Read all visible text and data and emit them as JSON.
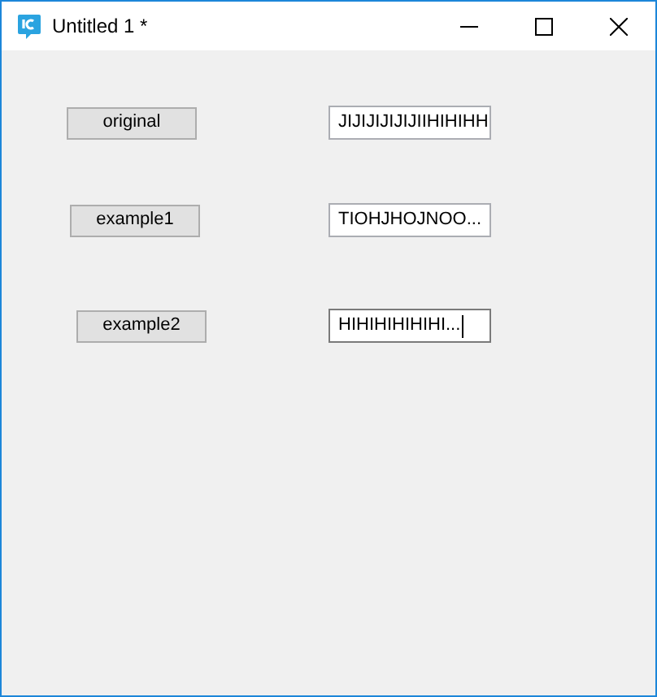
{
  "window": {
    "title": "Untitled 1 *"
  },
  "rows": [
    {
      "button": "original",
      "field": "JIJIJIJIJIJIIHIHIHH",
      "focused": false
    },
    {
      "button": "example1",
      "field": "TIOHJHOJNOO...",
      "focused": false
    },
    {
      "button": "example2",
      "field": "HIHIHIHIHIHI...",
      "focused": true
    }
  ]
}
